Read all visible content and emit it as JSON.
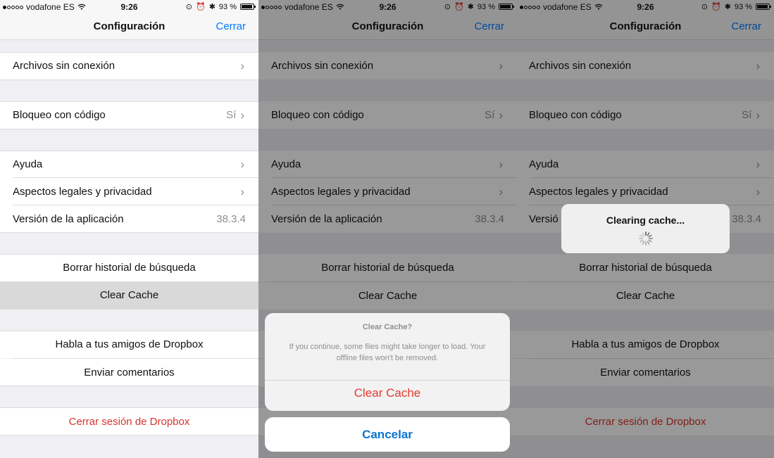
{
  "status": {
    "carrier": "vodafone ES",
    "time": "9:26",
    "battery": "93 %",
    "battery_level": 0.93,
    "icons": [
      "signal-dots-icon",
      "wifi-icon",
      "orientation-lock-icon",
      "alarm-icon",
      "bluetooth-icon",
      "battery-icon"
    ]
  },
  "nav": {
    "title": "Configuración",
    "close": "Cerrar"
  },
  "settings": {
    "offline": "Archivos sin conexión",
    "passcode": "Bloqueo con código",
    "passcode_value": "Sí",
    "help": "Ayuda",
    "legal": "Aspectos legales y privacidad",
    "version_label": "Versión de la aplicación",
    "version_label_truncated": "Versió",
    "version_value": "38.3.4",
    "clear_search": "Borrar historial de búsqueda",
    "clear_cache": "Clear Cache",
    "tell_friends": "Habla a tus amigos de Dropbox",
    "feedback": "Enviar comentarios",
    "sign_out": "Cerrar sesión de Dropbox"
  },
  "alert": {
    "title": "Clear Cache?",
    "message": "If you continue, some files might take longer to load. Your offline files won't be removed.",
    "action": "Clear Cache",
    "cancel": "Cancelar"
  },
  "hud": {
    "text": "Clearing cache..."
  },
  "colors": {
    "link": "#007aff",
    "destructive": "#d9342b",
    "cancel": "#0a75d0"
  }
}
